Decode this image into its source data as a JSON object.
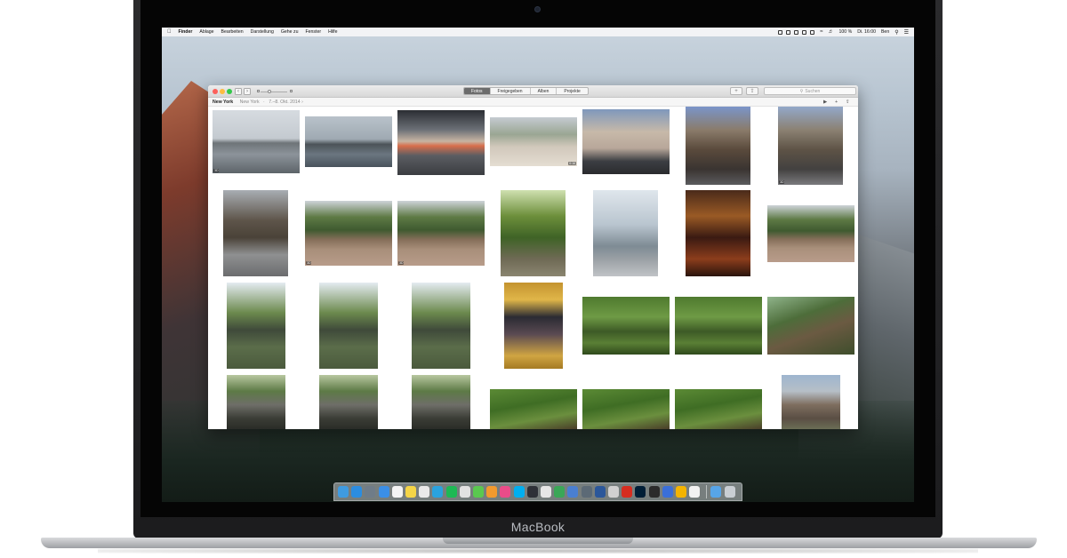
{
  "menubar": {
    "apple": "",
    "items": [
      "Finder",
      "Ablage",
      "Bearbeiten",
      "Darstellung",
      "Gehe zu",
      "Fenster",
      "Hilfe"
    ],
    "battery": "100 %",
    "clock": "Di. 16:00",
    "user": "Ben"
  },
  "window": {
    "nav_back": "‹",
    "nav_forward": "›",
    "tabs": [
      {
        "label": "Fotos",
        "active": true
      },
      {
        "label": "Freigegeben",
        "active": false
      },
      {
        "label": "Alben",
        "active": false
      },
      {
        "label": "Projekte",
        "active": false
      }
    ],
    "add_label": "+",
    "share_label": "⇪",
    "search_placeholder": "Suchen",
    "location_title": "New York",
    "location_sub": "New York",
    "date_range": "7.–8. Okt. 2014 ›",
    "play_label": "▶",
    "plus_label": "+",
    "share2_label": "⇪"
  },
  "photos": [
    {
      "label": "photo-harbor-1",
      "badge": "3D"
    },
    {
      "label": "photo-harbor-2",
      "badge": ""
    },
    {
      "label": "photo-street-market",
      "badge": ""
    },
    {
      "label": "photo-plaza",
      "badge": "",
      "duration": "0:16"
    },
    {
      "label": "photo-cars",
      "badge": ""
    },
    {
      "label": "photo-avenue",
      "badge": ""
    },
    {
      "label": "photo-avenue-2",
      "badge": "3D"
    },
    {
      "label": "photo-tower",
      "badge": ""
    },
    {
      "label": "photo-terrace-1",
      "badge": "3D"
    },
    {
      "label": "photo-terrace-2",
      "badge": "3D"
    },
    {
      "label": "photo-forest-path",
      "badge": ""
    },
    {
      "label": "photo-glass-cube",
      "badge": ""
    },
    {
      "label": "photo-theater",
      "badge": ""
    },
    {
      "label": "photo-terrace-3",
      "badge": ""
    },
    {
      "label": "photo-fountain-1",
      "badge": ""
    },
    {
      "label": "photo-fountain-2",
      "badge": ""
    },
    {
      "label": "photo-fountain-3",
      "badge": ""
    },
    {
      "label": "photo-poster",
      "badge": ""
    },
    {
      "label": "photo-bridge-1",
      "badge": ""
    },
    {
      "label": "photo-bridge-2",
      "badge": ""
    },
    {
      "label": "photo-woods",
      "badge": ""
    },
    {
      "label": "photo-rocks-1",
      "badge": ""
    },
    {
      "label": "photo-rocks-2",
      "badge": ""
    },
    {
      "label": "photo-rocks-3",
      "badge": ""
    },
    {
      "label": "photo-leaves-1",
      "badge": ""
    },
    {
      "label": "photo-leaves-2",
      "badge": ""
    },
    {
      "label": "photo-leaves-3",
      "badge": ""
    },
    {
      "label": "photo-city",
      "badge": ""
    }
  ],
  "dock": {
    "icons": [
      "finder-icon",
      "app-store-icon",
      "preview-icon",
      "safari-icon",
      "calendar-icon",
      "notes-icon",
      "documents-icon",
      "telegram-icon",
      "spotify-icon",
      "photos-icon",
      "messages-icon",
      "ibooks-icon",
      "itunes-icon",
      "skype-icon",
      "stocks-icon",
      "screenshot-icon",
      "numbers-icon",
      "keynote-icon",
      "time-machine-icon",
      "word-icon",
      "scrobbles-icon",
      "adobe-icon",
      "photoshop-icon",
      "terminal-icon",
      "globe-icon",
      "slides-icon",
      "textedit-icon",
      "downloads-folder-icon",
      "trash-icon"
    ]
  },
  "device": {
    "brand": "MacBook"
  },
  "colors": {
    "active_tab": "#6c6c6c",
    "close": "#fc605b",
    "minimize": "#fdbc40",
    "zoom": "#34c84a"
  }
}
